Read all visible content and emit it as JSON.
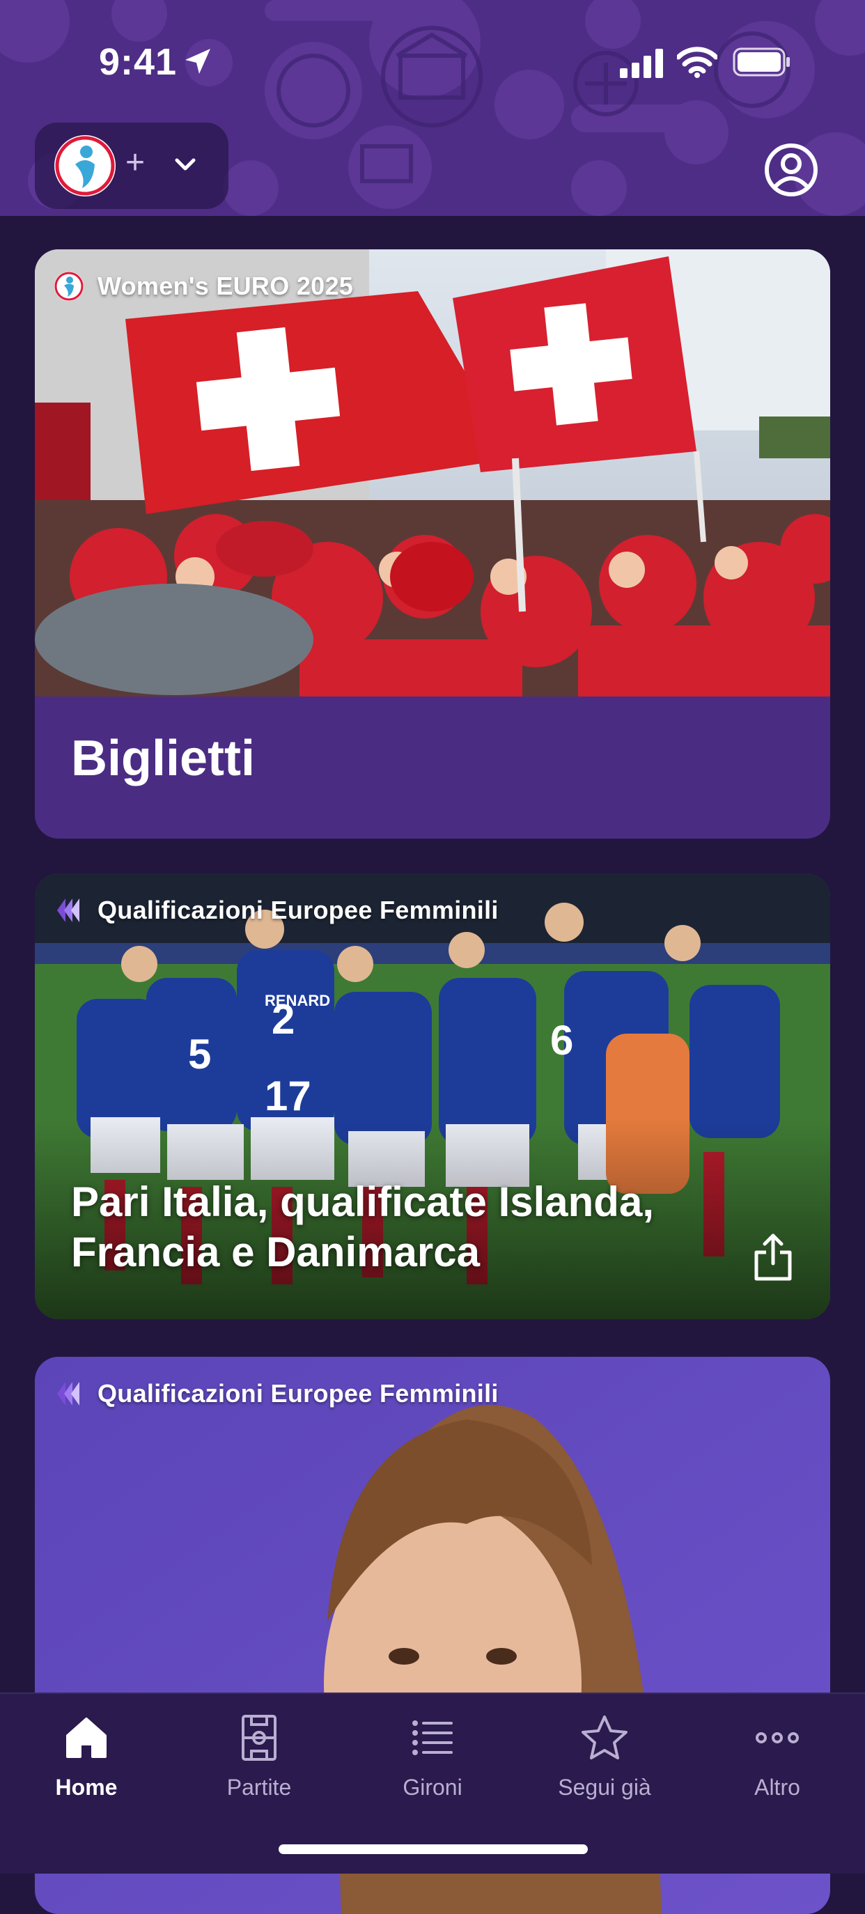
{
  "status_bar": {
    "time": "9:41"
  },
  "header": {
    "brand_logo": "womens-euro-logo",
    "add_label": "+",
    "profile_icon": "person-circle-icon"
  },
  "cards": [
    {
      "tag": "Women's EURO 2025",
      "tag_icon": "womens-euro-logo",
      "title": "Biglietti",
      "image": "swiss-fans-flags-photo"
    },
    {
      "tag": "Qualificazioni Europee Femminili",
      "tag_icon": "qualifiers-logo",
      "title": "Pari Italia, qualificate Islanda, Francia e Danimarca",
      "image": "france-team-huddle-photo",
      "share_icon": "share-icon"
    },
    {
      "tag": "Qualificazioni Europee Femminili",
      "tag_icon": "qualifiers-logo",
      "image": "woman-portrait-photo"
    }
  ],
  "tabbar": {
    "items": [
      {
        "label": "Home",
        "icon": "house-icon",
        "active": true
      },
      {
        "label": "Partite",
        "icon": "pitch-icon",
        "active": false
      },
      {
        "label": "Gironi",
        "icon": "list-icon",
        "active": false
      },
      {
        "label": "Segui già",
        "icon": "star-icon",
        "active": false
      },
      {
        "label": "Altro",
        "icon": "more-icon",
        "active": false
      }
    ]
  },
  "colors": {
    "background": "#22163f",
    "header": "#4e2d86",
    "card": "#4b2c83",
    "tabbar": "#2a1a4d",
    "accent_red": "#e0193a"
  }
}
